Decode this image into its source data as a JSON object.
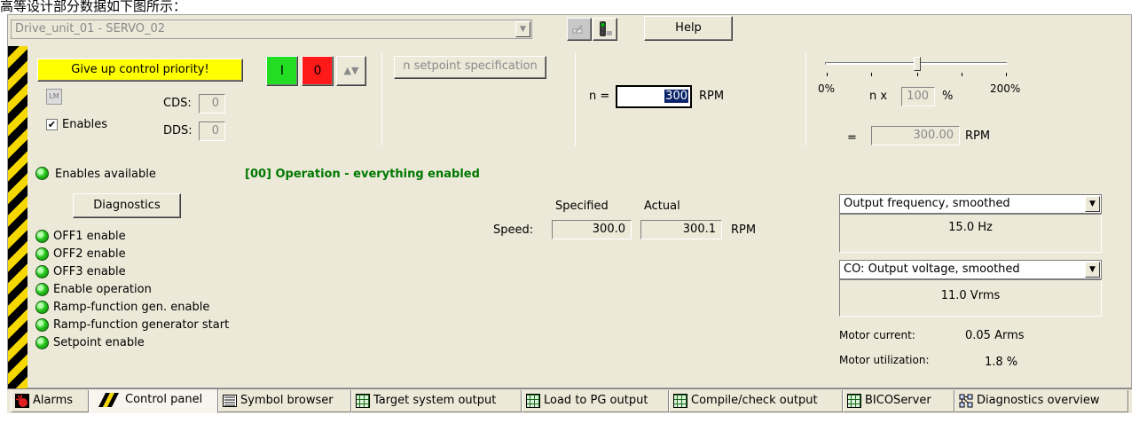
{
  "window": {
    "caption_fragment": "高等设计部分数据如下图所示："
  },
  "toolbar": {
    "drive_select": "Drive_unit_01 - SERVO_02",
    "help_label": "Help"
  },
  "control": {
    "give_up_label": "Give up control priority!",
    "on_label": "I",
    "off_label": "0",
    "enables_label": "Enables",
    "enables_checked": true,
    "cds_label": "CDS:",
    "cds_value": "0",
    "dds_label": "DDS:",
    "dds_value": "0",
    "lm_icon_text": "LM"
  },
  "setpoint": {
    "spec_label": "n setpoint specification",
    "n_eq_label": "n =",
    "n_value": "300",
    "rpm_unit": "RPM"
  },
  "scaling": {
    "min_label": "0%",
    "max_label": "200%",
    "n_x_label": "n x",
    "percent_value": "100",
    "percent_sign": "%",
    "equals": "=",
    "result_value": "300.00",
    "result_unit": "RPM",
    "slider_fraction": 0.5
  },
  "status": {
    "enables_available": "Enables available",
    "operation_text": "[00] Operation - everything enabled",
    "diagnostics_label": "Diagnostics",
    "enables": [
      "OFF1 enable",
      "OFF2 enable",
      "OFF3 enable",
      "Enable operation",
      "Ramp-function gen. enable",
      "Ramp-function generator start",
      "Setpoint enable"
    ]
  },
  "speed": {
    "label": "Speed:",
    "specified_header": "Specified",
    "actual_header": "Actual",
    "specified_value": "300.0",
    "actual_value": "300.1",
    "unit": "RPM"
  },
  "monitors": {
    "combo1": "Output frequency, smoothed",
    "value1": "15.0 Hz",
    "combo2": "CO: Output voltage, smoothed",
    "value2": "11.0 Vrms",
    "motor_current_label": "Motor current:",
    "motor_current_value": "0.05 Arms",
    "motor_util_label": "Motor utilization:",
    "motor_util_value": "1.8 %"
  },
  "tabs": [
    {
      "label": "Alarms",
      "icon": "alarm-icon"
    },
    {
      "label": "Control panel",
      "icon": "hazard-icon",
      "active": true
    },
    {
      "label": "Symbol browser",
      "icon": "symbol-browser-icon"
    },
    {
      "label": "Target system output",
      "icon": "table-icon"
    },
    {
      "label": "Load to PG output",
      "icon": "table-icon"
    },
    {
      "label": "Compile/check output",
      "icon": "table-icon"
    },
    {
      "label": "BICOServer",
      "icon": "table-icon"
    },
    {
      "label": "Diagnostics overview",
      "icon": "diagnostics-icon"
    }
  ],
  "colors": {
    "operation_text": "#007800",
    "give_up_bg": "#ffff00",
    "on_bg": "#22dd22",
    "off_bg": "#ff0000"
  }
}
